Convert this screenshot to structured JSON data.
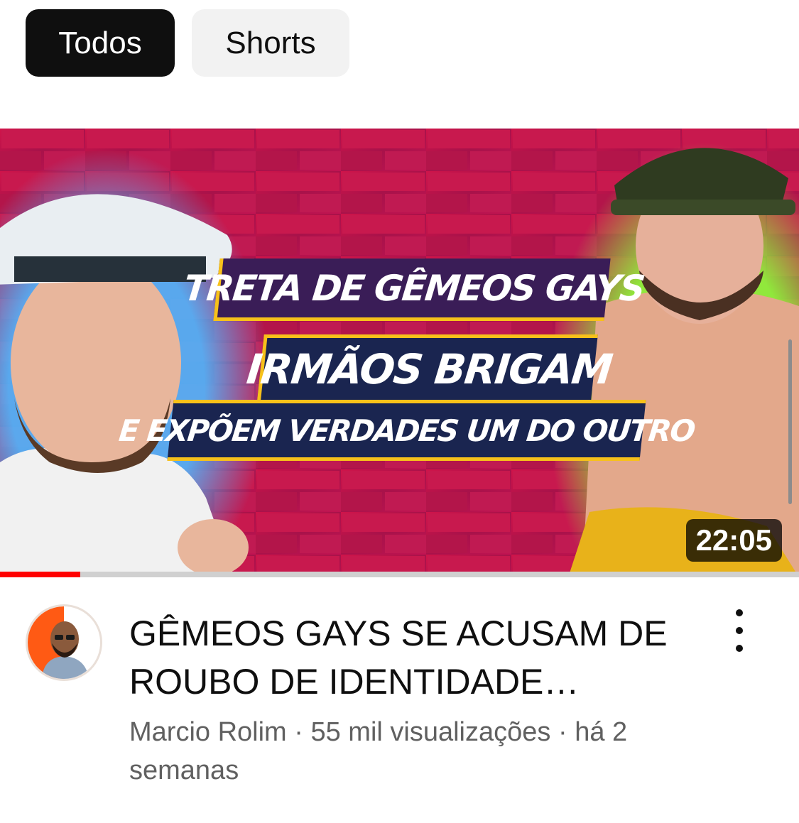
{
  "filters": {
    "all_label": "Todos",
    "shorts_label": "Shorts"
  },
  "video": {
    "thumbnail_text": {
      "line1": "TRETA DE GÊMEOS GAYS",
      "line2": "IRMÃOS BRIGAM",
      "line3": "E EXPÕEM VERDADES UM DO OUTRO"
    },
    "duration": "22:05",
    "watch_progress": 0.1,
    "title": "GÊMEOS GAYS SE ACUSAM DE ROUBO DE IDENTIDADE…",
    "channel": "Marcio Rolim",
    "separator": " · ",
    "views": "55 mil visualizações",
    "age": "há 2 semanas",
    "menu_icon": "more-vertical-icon"
  },
  "colors": {
    "chip_active_bg": "#0f0f0f",
    "chip_inactive_bg": "#f2f2f2",
    "progress": "#ff0000",
    "meta_text": "#606060"
  }
}
